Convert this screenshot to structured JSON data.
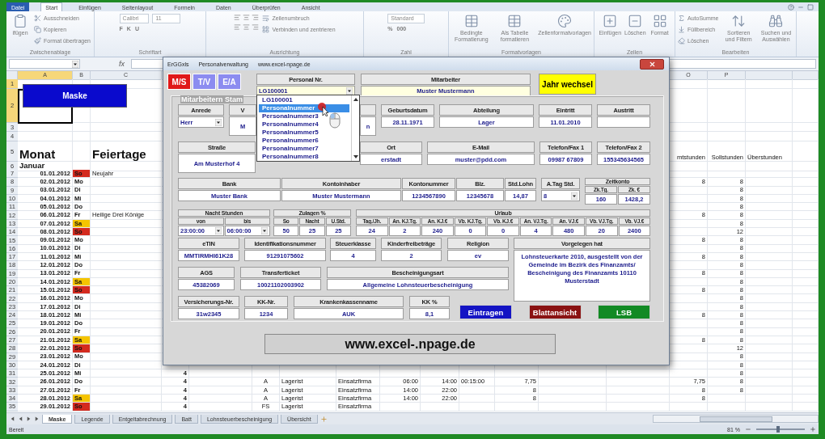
{
  "ribbon_tabs": [
    {
      "label": "Datei",
      "kind": "file",
      "selected": false
    },
    {
      "label": "Start",
      "kind": "tab",
      "selected": true
    },
    {
      "label": "Einfügen",
      "kind": "tab",
      "selected": false
    },
    {
      "label": "Seitenlayout",
      "kind": "tab",
      "selected": false
    },
    {
      "label": "Formeln",
      "kind": "tab",
      "selected": false
    },
    {
      "label": "Daten",
      "kind": "tab",
      "selected": false
    },
    {
      "label": "Überprüfen",
      "kind": "tab",
      "selected": false
    },
    {
      "label": "Ansicht",
      "kind": "tab",
      "selected": false
    }
  ],
  "ribbon_groups": [
    {
      "label": "Zwischenablage",
      "columns": [
        [
          {
            "kind": "large",
            "label": "ifügen"
          }
        ],
        [
          {
            "kind": "small",
            "label": "Ausschneiden"
          },
          {
            "kind": "small",
            "label": "Kopieren"
          },
          {
            "kind": "small",
            "label": "Format übertragen"
          }
        ]
      ]
    },
    {
      "label": "Schriftart",
      "columns": [
        [
          {
            "kind": "combo",
            "label": "Calibri"
          },
          {
            "kind": "keys",
            "labels": [
              "F",
              "K",
              "U"
            ]
          }
        ],
        [
          {
            "kind": "combo",
            "label": "11"
          }
        ]
      ]
    },
    {
      "label": "Ausrichtung",
      "columns": [
        [
          {
            "kind": "align_icons"
          },
          {
            "kind": "align_icons"
          }
        ],
        [
          {
            "kind": "small",
            "label": "Zeilenumbruch"
          },
          {
            "kind": "small",
            "label": "Verbinden und zentrieren"
          }
        ]
      ]
    },
    {
      "label": "Zahl",
      "columns": [
        [
          {
            "kind": "combo",
            "label": "Standard"
          },
          {
            "kind": "keys",
            "labels": [
              "%",
              "000"
            ]
          }
        ]
      ]
    },
    {
      "label": "Formatvorlagen",
      "columns": [
        [
          {
            "kind": "large",
            "label": "Bedingte Formatierung"
          }
        ],
        [
          {
            "kind": "large",
            "label": "Als Tabelle formatieren"
          }
        ],
        [
          {
            "kind": "large",
            "label": "Zellenformatvorlagen"
          }
        ]
      ]
    },
    {
      "label": "Zellen",
      "columns": [
        [
          {
            "kind": "large",
            "label": "Einfügen"
          }
        ],
        [
          {
            "kind": "large",
            "label": "Löschen"
          }
        ],
        [
          {
            "kind": "large",
            "label": "Format"
          }
        ]
      ]
    },
    {
      "label": "Bearbeiten",
      "columns": [
        [
          {
            "kind": "small",
            "label": "AutoSumme"
          },
          {
            "kind": "small",
            "label": "Füllbereich"
          },
          {
            "kind": "small",
            "label": "Löschen"
          }
        ],
        [
          {
            "kind": "large",
            "label": "Sortieren und Filtern"
          }
        ],
        [
          {
            "kind": "large",
            "label": "Suchen und Auswählen"
          }
        ]
      ]
    }
  ],
  "formula_bar": {
    "function_label": "fx"
  },
  "column_headers_left": [
    {
      "label": "A",
      "selected": true
    },
    {
      "label": "B",
      "selected": false
    },
    {
      "label": "C",
      "selected": false
    }
  ],
  "column_headers_right": [
    {
      "label": "O",
      "selected": false
    },
    {
      "label": "P",
      "selected": false
    }
  ],
  "sheet_button": {
    "label": "Maske"
  },
  "sheet_rows": [
    {
      "num": "1",
      "selected": true,
      "kind": "blank"
    },
    {
      "num": "2",
      "selected": true,
      "kind": "blank"
    },
    {
      "num": "3",
      "selected": false,
      "kind": "blank"
    },
    {
      "num": "4",
      "selected": false,
      "kind": "blank"
    },
    {
      "num": "5",
      "selected": false,
      "kind": "heading",
      "a": "Monat",
      "c": "Feiertage",
      "o": "mtstunden",
      "p": "Sollstunden",
      "q": "Überstunden"
    },
    {
      "num": "6",
      "selected": false,
      "kind": "month",
      "a": "Januar"
    },
    {
      "num": "7",
      "selected": false,
      "kind": "date",
      "a": "01.01.2012",
      "b": "So",
      "color": "#d42a1e",
      "c": "Neujahr"
    },
    {
      "num": "8",
      "selected": false,
      "kind": "date",
      "a": "02.01.2012",
      "b": "Mo",
      "o": "8",
      "p": "8"
    },
    {
      "num": "9",
      "selected": false,
      "kind": "date",
      "a": "03.01.2012",
      "b": "Di",
      "p": "8"
    },
    {
      "num": "10",
      "selected": false,
      "kind": "date",
      "a": "04.01.2012",
      "b": "Mi",
      "p": "8"
    },
    {
      "num": "11",
      "selected": false,
      "kind": "date",
      "a": "05.01.2012",
      "b": "Do",
      "p": "8"
    },
    {
      "num": "12",
      "selected": false,
      "kind": "date",
      "a": "06.01.2012",
      "b": "Fr",
      "c": "Heilige Drei Könige",
      "o": "8",
      "p": "8"
    },
    {
      "num": "13",
      "selected": false,
      "kind": "date",
      "a": "07.01.2012",
      "b": "Sa",
      "color": "#f5c400",
      "p": "8"
    },
    {
      "num": "14",
      "selected": false,
      "kind": "date",
      "a": "08.01.2012",
      "b": "So",
      "color": "#d42a1e",
      "p": "12"
    },
    {
      "num": "15",
      "selected": false,
      "kind": "date",
      "a": "09.01.2012",
      "b": "Mo",
      "o": "8",
      "p": "8"
    },
    {
      "num": "16",
      "selected": false,
      "kind": "date",
      "a": "10.01.2012",
      "b": "Di",
      "p": "8"
    },
    {
      "num": "17",
      "selected": false,
      "kind": "date",
      "a": "11.01.2012",
      "b": "Mi",
      "o": "8",
      "p": "8"
    },
    {
      "num": "18",
      "selected": false,
      "kind": "date",
      "a": "12.01.2012",
      "b": "Do",
      "p": "8"
    },
    {
      "num": "19",
      "selected": false,
      "kind": "date",
      "a": "13.01.2012",
      "b": "Fr",
      "o": "8",
      "p": "8"
    },
    {
      "num": "20",
      "selected": false,
      "kind": "date",
      "a": "14.01.2012",
      "b": "Sa",
      "color": "#f5c400",
      "p": "8"
    },
    {
      "num": "21",
      "selected": false,
      "kind": "date",
      "a": "15.01.2012",
      "b": "So",
      "color": "#d42a1e",
      "o": "8",
      "p": "8"
    },
    {
      "num": "22",
      "selected": false,
      "kind": "date",
      "a": "16.01.2012",
      "b": "Mo",
      "p": "8"
    },
    {
      "num": "23",
      "selected": false,
      "kind": "date",
      "a": "17.01.2012",
      "b": "Di",
      "p": "8"
    },
    {
      "num": "24",
      "selected": false,
      "kind": "date",
      "a": "18.01.2012",
      "b": "Mi",
      "o": "8",
      "p": "8"
    },
    {
      "num": "25",
      "selected": false,
      "kind": "date",
      "a": "19.01.2012",
      "b": "Do",
      "p": "8"
    },
    {
      "num": "26",
      "selected": false,
      "kind": "date",
      "a": "20.01.2012",
      "b": "Fr",
      "p": "8"
    },
    {
      "num": "27",
      "selected": false,
      "kind": "date",
      "a": "21.01.2012",
      "b": "Sa",
      "color": "#f5c400",
      "o": "8",
      "p": "8"
    },
    {
      "num": "28",
      "selected": false,
      "kind": "date",
      "a": "22.01.2012",
      "b": "So",
      "color": "#d42a1e",
      "p": "12"
    },
    {
      "num": "29",
      "selected": false,
      "kind": "date",
      "a": "23.01.2012",
      "b": "Mo",
      "p": "8"
    },
    {
      "num": "30",
      "selected": false,
      "kind": "date",
      "a": "24.01.2012",
      "b": "Di",
      "p": "8"
    },
    {
      "num": "31",
      "selected": false,
      "kind": "date",
      "a": "25.01.2012",
      "b": "Mi",
      "d": "4",
      "p": "8"
    },
    {
      "num": "32",
      "selected": false,
      "kind": "date",
      "a": "26.01.2012",
      "b": "Do",
      "d": "4",
      "f": "A",
      "g": "Lagerist",
      "h": "Einsatzfirma",
      "i": "06:00",
      "j": "14:00",
      "k": "00:15:00",
      "l": "7,75",
      "o": "7,75",
      "p": "8"
    },
    {
      "num": "33",
      "selected": false,
      "kind": "date",
      "a": "27.01.2012",
      "b": "Fr",
      "d": "4",
      "f": "A",
      "g": "Lagerist",
      "h": "Einsatzfirma",
      "i": "14:00",
      "j": "22:00",
      "l": "8",
      "o": "8",
      "p": "8"
    },
    {
      "num": "34",
      "selected": false,
      "kind": "date",
      "a": "28.01.2012",
      "b": "Sa",
      "color": "#f5c400",
      "d": "4",
      "f": "A",
      "g": "Lagerist",
      "h": "Einsatzfirma",
      "i": "14:00",
      "j": "22:00",
      "l": "8",
      "o": "8"
    },
    {
      "num": "35",
      "selected": false,
      "kind": "date",
      "a": "29.01.2012",
      "b": "So",
      "color": "#d42a1e",
      "d": "4",
      "f": "FS",
      "g": "Lagerist",
      "h": "Einsatzfirma"
    }
  ],
  "sheet_tabs": [
    {
      "label": "Maske",
      "selected": true
    },
    {
      "label": "Legende",
      "selected": false
    },
    {
      "label": "Entgeltabrechnung",
      "selected": false
    },
    {
      "label": "Batt",
      "selected": false
    },
    {
      "label": "Lohnsteuerbescheinigung",
      "selected": false
    },
    {
      "label": "Übersicht",
      "selected": false
    }
  ],
  "status_bar": {
    "text": "Bereit",
    "zoom": "81 %",
    "zoom_slider": {
      "level": 0.45
    }
  },
  "dialog": {
    "title": [
      "ErGGxls",
      "Personalverwaltung",
      "www.excel-npage.de"
    ],
    "modes": [
      {
        "label": "M/S",
        "selected": true
      },
      {
        "label": "T/V",
        "selected": false
      },
      {
        "label": "E/A",
        "selected": false
      }
    ],
    "personal_nr": {
      "label": "Personal Nr.",
      "value": "LG100001"
    },
    "mitarbeiter": {
      "label": "Mitarbeiter",
      "value": "Muster Mustermann"
    },
    "year_button": "Jahr wechsel",
    "frame_title": "Mitarbeitern Stam",
    "sections": [
      {
        "fields": [
          {
            "kind": "select",
            "label": "Anrede",
            "value": "Herr"
          },
          {
            "kind": "textarea",
            "label": "V",
            "value": "M"
          },
          {
            "kind": "textarea",
            "value": "n"
          },
          {
            "kind": "field",
            "label": "Geburtsdatum",
            "value": "28.11.1971"
          },
          {
            "kind": "field",
            "label": "Abteilung",
            "value": "Lager"
          },
          {
            "kind": "field",
            "label": "Eintritt",
            "value": "11.01.2010"
          },
          {
            "kind": "field",
            "label": "Austritt"
          }
        ]
      },
      {
        "fields": [
          {
            "kind": "textarea",
            "label": "Straße",
            "value": "Am Musterhof 4"
          },
          {
            "kind": "field",
            "label": "Ort",
            "value": "erstadt"
          },
          {
            "kind": "field",
            "label": "E-Mail",
            "value": "muster@pdd.com"
          },
          {
            "kind": "field",
            "label": "Telefon/Fax 1",
            "value": "09987 67809"
          },
          {
            "kind": "field",
            "label": "Telefon/Fax 2",
            "value": "155345634565"
          }
        ]
      },
      {
        "fields": [
          {
            "kind": "field",
            "label": "Bank",
            "value": "Muster Bank"
          },
          {
            "kind": "field",
            "label": "Kontoinhaber",
            "value": "Muster Mustermann"
          },
          {
            "kind": "field",
            "label": "Kontonummer",
            "value": "1234567890"
          },
          {
            "kind": "field",
            "label": "Blz.",
            "value": "12345678"
          },
          {
            "kind": "field",
            "label": "Std.Lohn",
            "value": "14,87"
          },
          {
            "kind": "select",
            "label": "A.Tag Std.",
            "value": "8"
          },
          {
            "kind": "group",
            "label": "Zeitkonto",
            "fields": [
              {
                "kind": "field",
                "label": "Zk.Tg.",
                "value": "160"
              },
              {
                "kind": "field",
                "label": "Zk. €",
                "value": "1428,2"
              }
            ]
          }
        ]
      },
      {
        "fields": [
          {
            "kind": "group",
            "label": "Nacht Stunden",
            "fields": [
              {
                "kind": "select",
                "label": "von",
                "value": "23:00:00"
              },
              {
                "kind": "select",
                "label": "bis",
                "value": "06:00:00"
              }
            ]
          },
          {
            "kind": "group",
            "label": "Zulagen %",
            "fields": [
              {
                "kind": "field",
                "label": "So",
                "value": "50"
              },
              {
                "kind": "field",
                "label": "Nacht",
                "value": "25"
              },
              {
                "kind": "field",
                "label": "Ü.Std.",
                "value": "25"
              }
            ]
          },
          {
            "kind": "group",
            "label": "Urlaub",
            "fields": [
              {
                "kind": "field",
                "label": "Tag./Jh.",
                "value": "24"
              },
              {
                "kind": "field",
                "label": "An. KJ.Tg.",
                "value": "2"
              },
              {
                "kind": "field",
                "label": "An. KJ.€",
                "value": "240"
              },
              {
                "kind": "field",
                "label": "Vb. KJ.Tg.",
                "value": "0"
              },
              {
                "kind": "field",
                "label": "Vb. KJ.€",
                "value": "0"
              },
              {
                "kind": "field",
                "label": "An. VJ.Tg.",
                "value": "4"
              },
              {
                "kind": "field",
                "label": "An. VJ.€",
                "value": "480"
              },
              {
                "kind": "field",
                "label": "Vb. VJ.Tg.",
                "value": "20"
              },
              {
                "kind": "field",
                "label": "Vb. VJ.€",
                "value": "2400"
              }
            ]
          }
        ]
      },
      {
        "fields": [
          {
            "kind": "field",
            "label": "eTIN",
            "value": "MMTIRMHI61K28"
          },
          {
            "kind": "field",
            "label": "Identifikationsnummer",
            "value": "91291075602"
          },
          {
            "kind": "field",
            "label": "Steuerklasse",
            "value": "4"
          },
          {
            "kind": "field",
            "label": "Kinderfreibeträge",
            "value": "2"
          },
          {
            "kind": "field",
            "label": "Religion",
            "value": "ev"
          }
        ]
      },
      {
        "fields": [
          {
            "kind": "field",
            "label": "AGS",
            "value": "45382069"
          },
          {
            "kind": "field",
            "label": "Transferticket",
            "value": "10021102003902"
          },
          {
            "kind": "field",
            "label": "Bescheinigungsart",
            "value": "Allgemeine Lohnsteuerbescheinigung"
          }
        ]
      },
      {
        "fields": [
          {
            "kind": "field",
            "label": "Versicherungs-Nr.",
            "value": "31w2345"
          },
          {
            "kind": "field",
            "label": "KK-Nr.",
            "value": "1234"
          },
          {
            "kind": "field",
            "label": "Krankenkassenname",
            "value": "AUK"
          },
          {
            "kind": "field",
            "label": "KK %",
            "value": "8,1"
          }
        ]
      }
    ],
    "note": {
      "label": "Vorgelegen hat",
      "text": "Lohnsteuerkarte 2010, ausgestellt von der Gemeinde im Bezirk des Finanzamts/ Bescheinigung des Finanzamts 10110 Musterstadt"
    },
    "buttons": [
      {
        "label": "Eintragen",
        "color": "#1414c4"
      },
      {
        "label": "Blattansicht",
        "color": "#8a1212"
      },
      {
        "label": "LSB",
        "color": "#128a24"
      }
    ],
    "footer": "www.excel-.npage.de",
    "dropdown": [
      {
        "label": "LG100001",
        "selected": false
      },
      {
        "label": "Personalnummer",
        "selected": true
      },
      {
        "label": "Personalnummer3",
        "selected": false
      },
      {
        "label": "Personalnummer4",
        "selected": false
      },
      {
        "label": "Personalnummer5",
        "selected": false
      },
      {
        "label": "Personalnummer6",
        "selected": false
      },
      {
        "label": "Personalnummer7",
        "selected": false
      },
      {
        "label": "Personalnummer8",
        "selected": false
      }
    ]
  }
}
